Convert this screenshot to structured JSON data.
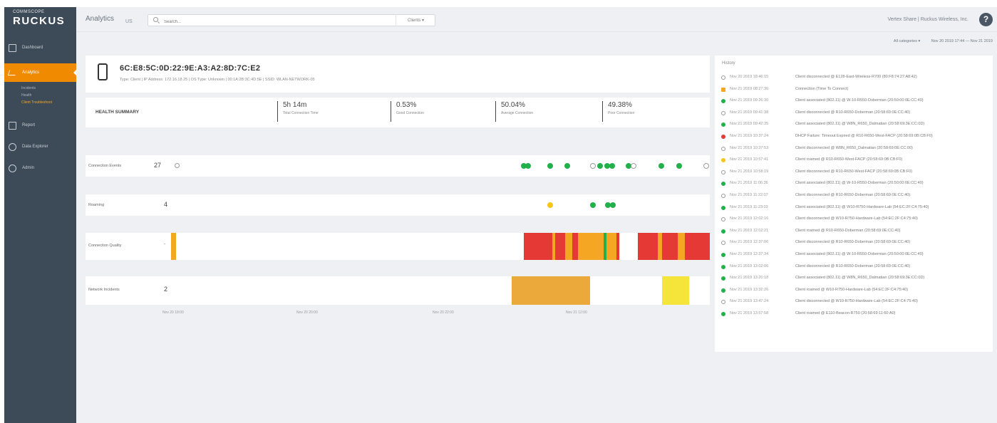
{
  "brand": {
    "top": "COMMSCOPE",
    "name": "RUCKUS"
  },
  "sidebar": {
    "items": [
      {
        "label": "Dashboard"
      },
      {
        "label": "Analytics"
      },
      {
        "label": "Report"
      },
      {
        "label": "Data Explorer"
      },
      {
        "label": "Admin"
      }
    ],
    "subitems": [
      "Incidents",
      "Health",
      "Client Troubleshoot"
    ]
  },
  "topbar": {
    "title": "Analytics",
    "region": "US",
    "search_placeholder": "Search...",
    "scope": "Clients ▾",
    "account": "Vertex Share | Ruckus Wireless, Inc.",
    "help": "?"
  },
  "filters": {
    "category": "All categories ▾",
    "range": "Nov 20 2019 17:44 — Nov 21 2019"
  },
  "client": {
    "name": "6C:E8:5C:0D:22:9E:A3:A2:8D:7C:E2",
    "meta": "Type: Client | IP Address: 172.16.18.25 | OS Type: Unknown | 00:1A:2B:3C:4D:5E | SSID: WLAN-NETWORK-05"
  },
  "health": {
    "title": "HEALTH SUMMARY",
    "metrics": [
      {
        "value": "5h 14m",
        "label": "Total Connection Time"
      },
      {
        "value": "0.53%",
        "label": "Good Connection"
      },
      {
        "value": "50.04%",
        "label": "Average Connection"
      },
      {
        "value": "49.38%",
        "label": "Poor Connection"
      }
    ]
  },
  "rows": {
    "events": {
      "label": "Connection Events",
      "count": "27"
    },
    "roaming": {
      "label": "Roaming",
      "count": "4"
    },
    "quality": {
      "label": "Connection Quality",
      "count": "-"
    },
    "incidents": {
      "label": "Network Incidents",
      "count": "2"
    }
  },
  "axis_ticks": [
    "Nov 20 18:00",
    "Nov 20 20:00",
    "Nov 20 22:00",
    "Nov 21 12:00"
  ],
  "history": {
    "title": "History",
    "items": [
      {
        "status": "clock",
        "ts": "Nov 20 2019 18:46:15",
        "msg": "Client disconnected @ E128-East-Wireless-R700 (80:F8:74:27:A8:42)"
      },
      {
        "status": "square",
        "ts": "Nov 21 2019 08:27:36",
        "msg": "Connection (Time To Connect)"
      },
      {
        "status": "green",
        "ts": "Nov 21 2019 09:26:30",
        "msg": "Client associated (802.11) @ W-10-R550-Doberman (20:50:00:0E:CC:40)"
      },
      {
        "status": "clock",
        "ts": "Nov 21 2019 09:41:38",
        "msg": "Client disconnected @ R10-R650-Doberman (20:58:69:0E:CC:40)"
      },
      {
        "status": "green",
        "ts": "Nov 21 2019 09:42:35",
        "msg": "Client associated (802.11) @ W8N_R650_Dalmatian (20:58:69:3E:CC:0D)"
      },
      {
        "status": "red",
        "ts": "Nov 21 2019 10:37:24",
        "msg": "DHCP Failure: Timeout Expired @ R10-R650-West-FACP (20:58:69:0B:CB:F0)"
      },
      {
        "status": "clock",
        "ts": "Nov 21 2019 10:37:53",
        "msg": "Client disconnected @ W8N_R650_Dalmatian (20:58:69:0E:CC:00)"
      },
      {
        "status": "yellow",
        "ts": "Nov 21 2019 10:57:41",
        "msg": "Client roamed @ R10-R650-West-FACP (20:58:69:0B:CB:F0)"
      },
      {
        "status": "clock",
        "ts": "Nov 21 2019 10:58:19",
        "msg": "Client disconnected @ R10-R650-West-FACP (20:58:69:0B:CB:F0)"
      },
      {
        "status": "green",
        "ts": "Nov 21 2019 11:06:36",
        "msg": "Client associated (802.11) @ W-10-R550-Doberman (20:50:00:0E:CC:40)"
      },
      {
        "status": "clock",
        "ts": "Nov 21 2019 11:22:07",
        "msg": "Client disconnected @ R10-R650-Doberman (20:58:69:0E:CC:40)"
      },
      {
        "status": "green",
        "ts": "Nov 21 2019 11:23:03",
        "msg": "Client associated (802.11) @ W10-R750-Hardware-Lab (54:EC:2F:C4:75:40)"
      },
      {
        "status": "clock",
        "ts": "Nov 21 2019 12:02:16",
        "msg": "Client disconnected @ W10-R750-Hardware-Lab (54:EC:2F:C4:75:40)"
      },
      {
        "status": "green",
        "ts": "Nov 21 2019 12:02:21",
        "msg": "Client roamed @ R10-R650-Doberman (20:58:69:0E:CC:40)"
      },
      {
        "status": "clock",
        "ts": "Nov 21 2019 12:37:06",
        "msg": "Client disconnected @ R10-R650-Doberman (20:58:69:0E:CC:40)"
      },
      {
        "status": "green",
        "ts": "Nov 21 2019 12:37:34",
        "msg": "Client associated (802.11) @ W-10-R550-Doberman (20:50:00:0E:CC:40)"
      },
      {
        "status": "green",
        "ts": "Nov 21 2019 13:02:06",
        "msg": "Client disconnected @ R10-R650-Doberman (20:58:69:0E:CC:40)"
      },
      {
        "status": "green",
        "ts": "Nov 21 2019 13:20:18",
        "msg": "Client associated (802.11) @ W8N_R650_Dalmatian (20:58:69:3E:CC:0D)"
      },
      {
        "status": "green",
        "ts": "Nov 21 2019 13:32:26",
        "msg": "Client roamed @ W10-R750-Hardware-Lab (54:EC:2F:C4:75:40)"
      },
      {
        "status": "clock",
        "ts": "Nov 21 2019 13:47:24",
        "msg": "Client disconnected @ W10-R750-Hardware-Lab (54:EC:2F:C4:75:40)"
      },
      {
        "status": "green",
        "ts": "Nov 21 2019 13:57:58",
        "msg": "Client roamed @ E110-Beacon-R750 (20:58:69:11:60:A0)"
      }
    ]
  },
  "colors": {
    "good": "#22b04b",
    "roam": "#f5c518",
    "poor": "#e53935",
    "average": "#f5a623",
    "incident_orange": "#eba93b",
    "incident_yellow": "#f5e43a",
    "accent": "#f08a00",
    "sidebar": "#3d4b59"
  }
}
